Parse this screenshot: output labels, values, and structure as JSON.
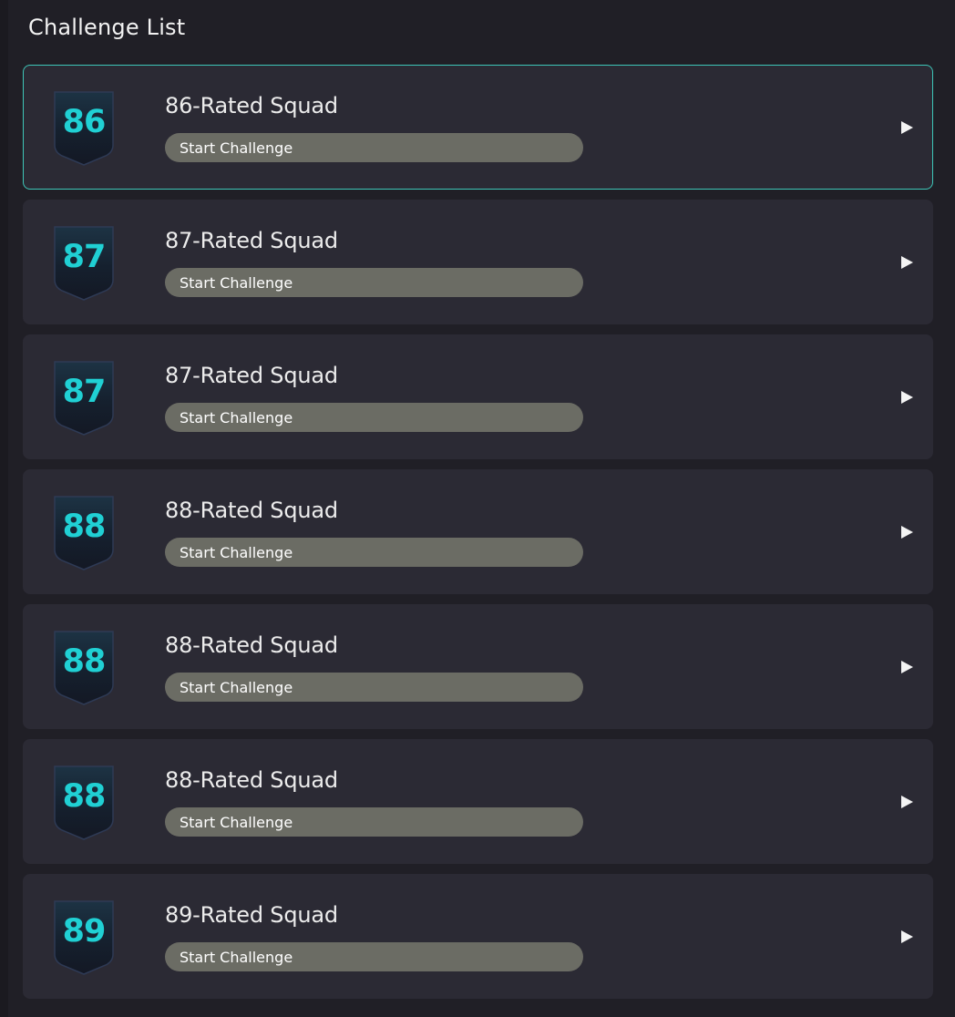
{
  "header": {
    "title": "Challenge List"
  },
  "challenges": [
    {
      "rating": "86",
      "title": "86-Rated Squad",
      "action_label": "Start Challenge",
      "selected": true
    },
    {
      "rating": "87",
      "title": "87-Rated Squad",
      "action_label": "Start Challenge",
      "selected": false
    },
    {
      "rating": "87",
      "title": "87-Rated Squad",
      "action_label": "Start Challenge",
      "selected": false
    },
    {
      "rating": "88",
      "title": "88-Rated Squad",
      "action_label": "Start Challenge",
      "selected": false
    },
    {
      "rating": "88",
      "title": "88-Rated Squad",
      "action_label": "Start Challenge",
      "selected": false
    },
    {
      "rating": "88",
      "title": "88-Rated Squad",
      "action_label": "Start Challenge",
      "selected": false
    },
    {
      "rating": "89",
      "title": "89-Rated Squad",
      "action_label": "Start Challenge",
      "selected": false
    }
  ],
  "icons": {
    "badge": "shield-badge-icon",
    "arrow": "play-arrow-icon"
  },
  "colors": {
    "accent": "#3ec6b8",
    "rating_text": "#20d0d4",
    "card_bg": "#2b2a34",
    "button_bg": "#6b6c64"
  }
}
